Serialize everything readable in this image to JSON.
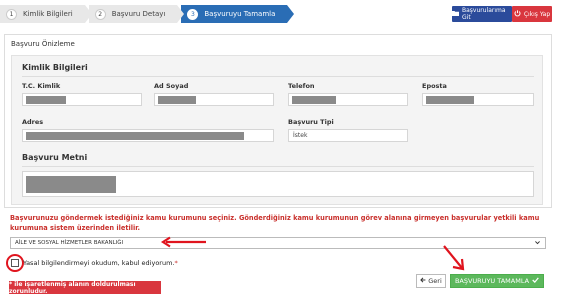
{
  "steps": [
    {
      "num": "1",
      "label": "Kimlik Bilgileri"
    },
    {
      "num": "2",
      "label": "Başvuru Detayı"
    },
    {
      "num": "3",
      "label": "Başvuruyu Tamamla"
    }
  ],
  "header": {
    "apps_label": "Başvurularıma Git",
    "logout_label": "Çıkış Yap"
  },
  "panel": {
    "title": "Başvuru Önizleme",
    "identity_title": "Kimlik Bilgileri",
    "fields": {
      "tc_label": "T.C. Kimlik",
      "name_label": "Ad Soyad",
      "phone_label": "Telefon",
      "email_label": "Eposta",
      "address_label": "Adres",
      "type_label": "Başvuru Tipi",
      "type_value": "İstek"
    },
    "text_title": "Başvuru Metni"
  },
  "notice": "Başvurunuzu göndermek istediğiniz kamu kurumunu seçiniz. Gönderdiğiniz kamu kurumunun görev alanına girmeyen başvurular yetkili kamu kurumuna sistem üzerinden iletilir.",
  "institution_select": {
    "value": "AİLE VE SOSYAL HİZMETLER BAKANLIĞI"
  },
  "consent": {
    "label": "Yasal bilgilendirmeyi okudum, kabul ediyorum.",
    "required_mark": "*"
  },
  "required_notice": "* ile işaretlenmiş alanın doldurulması zorunludur.",
  "buttons": {
    "back_label": "Geri",
    "finish_label": "BAŞVURUYU TAMAMLA"
  },
  "colors": {
    "primary": "#2a6db5",
    "danger": "#d9363e",
    "success": "#5cb85c",
    "annotation": "#e0141e"
  }
}
